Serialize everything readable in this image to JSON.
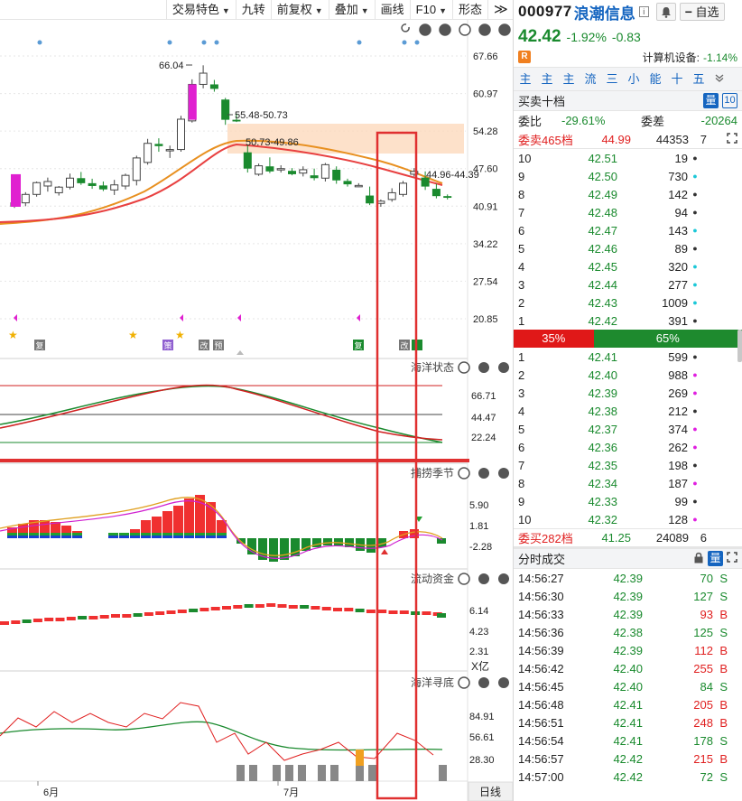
{
  "toolbar": {
    "items": [
      "交易特色",
      "九转",
      "前复权",
      "叠加",
      "画线",
      "F10",
      "形态"
    ],
    "more": "≫"
  },
  "chart": {
    "price_ticks": [
      "67.66",
      "60.97",
      "54.28",
      "47.60",
      "40.91",
      "34.22",
      "27.54",
      "20.85"
    ],
    "annotations": {
      "high": "66.04",
      "zone1": "55.48-50.73",
      "zone2": "50.73-49.86",
      "zone3": "44.96-44.39"
    },
    "marker_labels": [
      "复",
      "策",
      "改",
      "预",
      "复",
      "改"
    ],
    "panels": [
      {
        "name": "海洋状态",
        "ticks": [
          "66.71",
          "44.47",
          "22.24"
        ]
      },
      {
        "name": "捕捞季节",
        "ticks": [
          "5.90",
          "1.81",
          "-2.28"
        ]
      },
      {
        "name": "流动资金",
        "ticks": [
          "6.14",
          "4.23",
          "2.31"
        ],
        "unit": "X亿"
      },
      {
        "name": "海洋寻底",
        "ticks": [
          "84.91",
          "56.61",
          "28.30"
        ]
      }
    ],
    "months": [
      "6月",
      "7月"
    ],
    "period": "日线"
  },
  "chart_data": {
    "type": "candlestick",
    "candles": [
      {
        "o": 40.9,
        "h": 42.4,
        "l": 40.6,
        "c": 41.5
      },
      {
        "o": 41.5,
        "h": 43.4,
        "l": 40.9,
        "c": 43.0
      },
      {
        "o": 43.0,
        "h": 45.3,
        "l": 42.6,
        "c": 45.1
      },
      {
        "o": 44.5,
        "h": 46.0,
        "l": 43.5,
        "c": 45.3
      },
      {
        "o": 43.3,
        "h": 44.5,
        "l": 42.8,
        "c": 44.3
      },
      {
        "o": 44.3,
        "h": 46.7,
        "l": 43.9,
        "c": 45.9
      },
      {
        "o": 45.9,
        "h": 47.0,
        "l": 44.7,
        "c": 45.0
      },
      {
        "o": 45.0,
        "h": 45.8,
        "l": 44.0,
        "c": 44.5
      },
      {
        "o": 44.6,
        "h": 45.3,
        "l": 43.6,
        "c": 43.9
      },
      {
        "o": 43.8,
        "h": 45.6,
        "l": 42.9,
        "c": 44.7
      },
      {
        "o": 44.5,
        "h": 46.7,
        "l": 43.9,
        "c": 46.4
      },
      {
        "o": 45.5,
        "h": 49.9,
        "l": 44.6,
        "c": 49.5
      },
      {
        "o": 48.7,
        "h": 52.9,
        "l": 48.3,
        "c": 52.1
      },
      {
        "o": 52.0,
        "h": 53.0,
        "l": 50.6,
        "c": 51.6
      },
      {
        "o": 50.9,
        "h": 51.7,
        "l": 49.5,
        "c": 51.0
      },
      {
        "o": 51.0,
        "h": 57.0,
        "l": 50.6,
        "c": 56.4
      },
      {
        "o": 56.1,
        "h": 63.5,
        "l": 55.8,
        "c": 62.6
      },
      {
        "o": 62.6,
        "h": 66.0,
        "l": 61.9,
        "c": 64.6
      },
      {
        "o": 62.6,
        "h": 63.4,
        "l": 61.3,
        "c": 61.8
      },
      {
        "o": 59.9,
        "h": 60.2,
        "l": 55.4,
        "c": 56.3
      },
      {
        "o": 56.3,
        "h": 57.4,
        "l": 55.9,
        "c": 56.0
      },
      {
        "o": 50.5,
        "h": 51.7,
        "l": 46.9,
        "c": 47.6
      },
      {
        "o": 46.6,
        "h": 48.5,
        "l": 46.3,
        "c": 48.1
      },
      {
        "o": 48.0,
        "h": 49.6,
        "l": 46.8,
        "c": 47.1
      },
      {
        "o": 47.4,
        "h": 48.2,
        "l": 46.9,
        "c": 47.6
      },
      {
        "o": 47.2,
        "h": 47.7,
        "l": 46.4,
        "c": 46.6
      },
      {
        "o": 46.8,
        "h": 48.0,
        "l": 46.2,
        "c": 47.4
      },
      {
        "o": 46.4,
        "h": 47.6,
        "l": 45.5,
        "c": 45.9
      },
      {
        "o": 45.9,
        "h": 48.6,
        "l": 45.3,
        "c": 48.3
      },
      {
        "o": 47.4,
        "h": 48.0,
        "l": 44.9,
        "c": 45.5
      },
      {
        "o": 45.4,
        "h": 45.8,
        "l": 44.4,
        "c": 44.8
      },
      {
        "o": 44.6,
        "h": 45.0,
        "l": 44.3,
        "c": 44.6
      },
      {
        "o": 42.8,
        "h": 44.4,
        "l": 41.1,
        "c": 41.4
      },
      {
        "o": 41.4,
        "h": 42.1,
        "l": 40.8,
        "c": 41.8
      },
      {
        "o": 42.1,
        "h": 44.1,
        "l": 41.7,
        "c": 43.3
      },
      {
        "o": 43.0,
        "h": 45.4,
        "l": 42.6,
        "c": 45.0
      },
      {
        "o": 46.6,
        "h": 47.7,
        "l": 46.2,
        "c": 47.1
      },
      {
        "o": 46.0,
        "h": 47.1,
        "l": 43.8,
        "c": 44.4
      },
      {
        "o": 44.0,
        "h": 44.9,
        "l": 42.3,
        "c": 42.7
      },
      {
        "o": 42.7,
        "h": 43.0,
        "l": 42.1,
        "c": 42.4
      }
    ],
    "ylim": [
      20.85,
      67.66
    ]
  },
  "quote": {
    "code": "000977",
    "name": "浪潮信息",
    "watch": "自选",
    "price": "42.42",
    "pct": "-1.92%",
    "change": "-0.83",
    "badge": "R",
    "sector": "计算机设备:",
    "sector_pct": "-1.14%",
    "tabs": [
      "主",
      "主",
      "主",
      "流",
      "三",
      "小",
      "能",
      "十",
      "五"
    ]
  },
  "orderbook": {
    "title": "买卖十档",
    "tab_a": "量",
    "tab_b": "10",
    "wb_label": "委比",
    "wb_val": "-29.61%",
    "wc_label": "委差",
    "wc_val": "-20264",
    "sell_label": "委卖465档",
    "sell_price": "44.99",
    "sell_vol": "44353",
    "sell_n": "7",
    "asks": [
      {
        "lv": "10",
        "p": "42.51",
        "v": "19",
        "dot": "#333"
      },
      {
        "lv": "9",
        "p": "42.50",
        "v": "730",
        "dot": "#1dc8d8"
      },
      {
        "lv": "8",
        "p": "42.49",
        "v": "142",
        "dot": "#333"
      },
      {
        "lv": "7",
        "p": "42.48",
        "v": "94",
        "dot": "#333"
      },
      {
        "lv": "6",
        "p": "42.47",
        "v": "143",
        "dot": "#1dc8d8"
      },
      {
        "lv": "5",
        "p": "42.46",
        "v": "89",
        "dot": "#333"
      },
      {
        "lv": "4",
        "p": "42.45",
        "v": "320",
        "dot": "#1dc8d8"
      },
      {
        "lv": "3",
        "p": "42.44",
        "v": "277",
        "dot": "#1dc8d8"
      },
      {
        "lv": "2",
        "p": "42.43",
        "v": "1009",
        "dot": "#1dc8d8"
      },
      {
        "lv": "1",
        "p": "42.42",
        "v": "391",
        "dot": "#333"
      }
    ],
    "ratio_red": "35%",
    "ratio_green": "65%",
    "ratio_red_frac": 0.35,
    "bids": [
      {
        "lv": "1",
        "p": "42.41",
        "v": "599",
        "dot": "#333"
      },
      {
        "lv": "2",
        "p": "42.40",
        "v": "988",
        "dot": "#e020e0"
      },
      {
        "lv": "3",
        "p": "42.39",
        "v": "269",
        "dot": "#e020e0"
      },
      {
        "lv": "4",
        "p": "42.38",
        "v": "212",
        "dot": "#333"
      },
      {
        "lv": "5",
        "p": "42.37",
        "v": "374",
        "dot": "#e020e0"
      },
      {
        "lv": "6",
        "p": "42.36",
        "v": "262",
        "dot": "#e020e0"
      },
      {
        "lv": "7",
        "p": "42.35",
        "v": "198",
        "dot": "#333"
      },
      {
        "lv": "8",
        "p": "42.34",
        "v": "187",
        "dot": "#e020e0"
      },
      {
        "lv": "9",
        "p": "42.33",
        "v": "99",
        "dot": "#333"
      },
      {
        "lv": "10",
        "p": "42.32",
        "v": "128",
        "dot": "#e020e0"
      }
    ],
    "buy_label": "委买282档",
    "buy_price": "41.25",
    "buy_vol": "24089",
    "buy_n": "6"
  },
  "ticks": {
    "title": "分时成交",
    "tab": "量",
    "rows": [
      {
        "t": "14:56:27",
        "p": "42.39",
        "v": "70",
        "s": "S"
      },
      {
        "t": "14:56:30",
        "p": "42.39",
        "v": "127",
        "s": "S"
      },
      {
        "t": "14:56:33",
        "p": "42.39",
        "v": "93",
        "s": "B"
      },
      {
        "t": "14:56:36",
        "p": "42.38",
        "v": "125",
        "s": "S"
      },
      {
        "t": "14:56:39",
        "p": "42.39",
        "v": "112",
        "s": "B"
      },
      {
        "t": "14:56:42",
        "p": "42.40",
        "v": "255",
        "s": "B"
      },
      {
        "t": "14:56:45",
        "p": "42.40",
        "v": "84",
        "s": "S"
      },
      {
        "t": "14:56:48",
        "p": "42.41",
        "v": "205",
        "s": "B"
      },
      {
        "t": "14:56:51",
        "p": "42.41",
        "v": "248",
        "s": "B"
      },
      {
        "t": "14:56:54",
        "p": "42.41",
        "v": "178",
        "s": "S"
      },
      {
        "t": "14:56:57",
        "p": "42.42",
        "v": "215",
        "s": "B"
      },
      {
        "t": "14:57:00",
        "p": "42.42",
        "v": "72",
        "s": "S"
      }
    ]
  }
}
